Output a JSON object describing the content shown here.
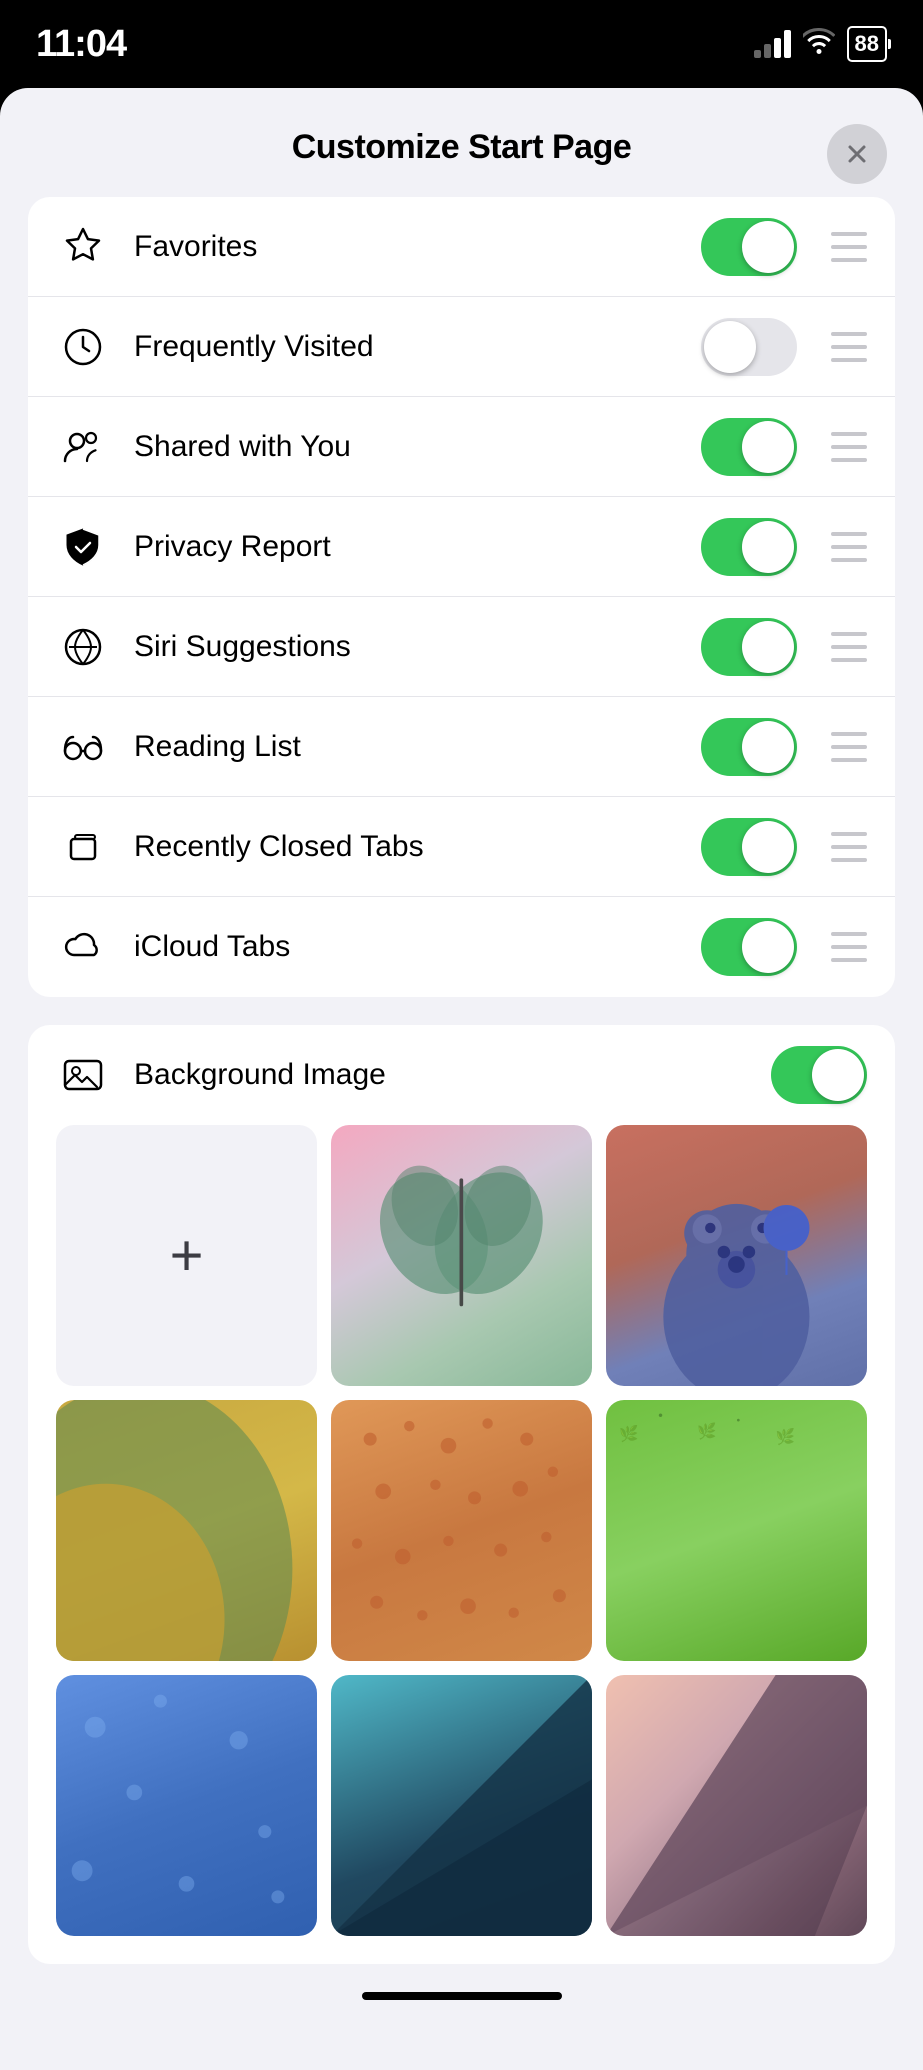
{
  "statusBar": {
    "time": "11:04",
    "battery": "88"
  },
  "sheet": {
    "title": "Customize Start Page",
    "closeLabel": "×"
  },
  "settings": {
    "items": [
      {
        "id": "favorites",
        "label": "Favorites",
        "icon": "star",
        "enabled": true
      },
      {
        "id": "frequently-visited",
        "label": "Frequently Visited",
        "icon": "clock",
        "enabled": false
      },
      {
        "id": "shared-with-you",
        "label": "Shared with You",
        "icon": "people",
        "enabled": true
      },
      {
        "id": "privacy-report",
        "label": "Privacy Report",
        "icon": "shield",
        "enabled": true
      },
      {
        "id": "siri-suggestions",
        "label": "Siri Suggestions",
        "icon": "siri",
        "enabled": true
      },
      {
        "id": "reading-list",
        "label": "Reading List",
        "icon": "glasses",
        "enabled": true
      },
      {
        "id": "recently-closed-tabs",
        "label": "Recently Closed Tabs",
        "icon": "tabs",
        "enabled": true
      },
      {
        "id": "icloud-tabs",
        "label": "iCloud Tabs",
        "icon": "cloud",
        "enabled": true
      }
    ]
  },
  "backgroundImage": {
    "label": "Background Image",
    "enabled": true,
    "addLabel": "+"
  },
  "colors": {
    "toggleOn": "#34c759",
    "toggleOff": "#e5e5ea"
  }
}
